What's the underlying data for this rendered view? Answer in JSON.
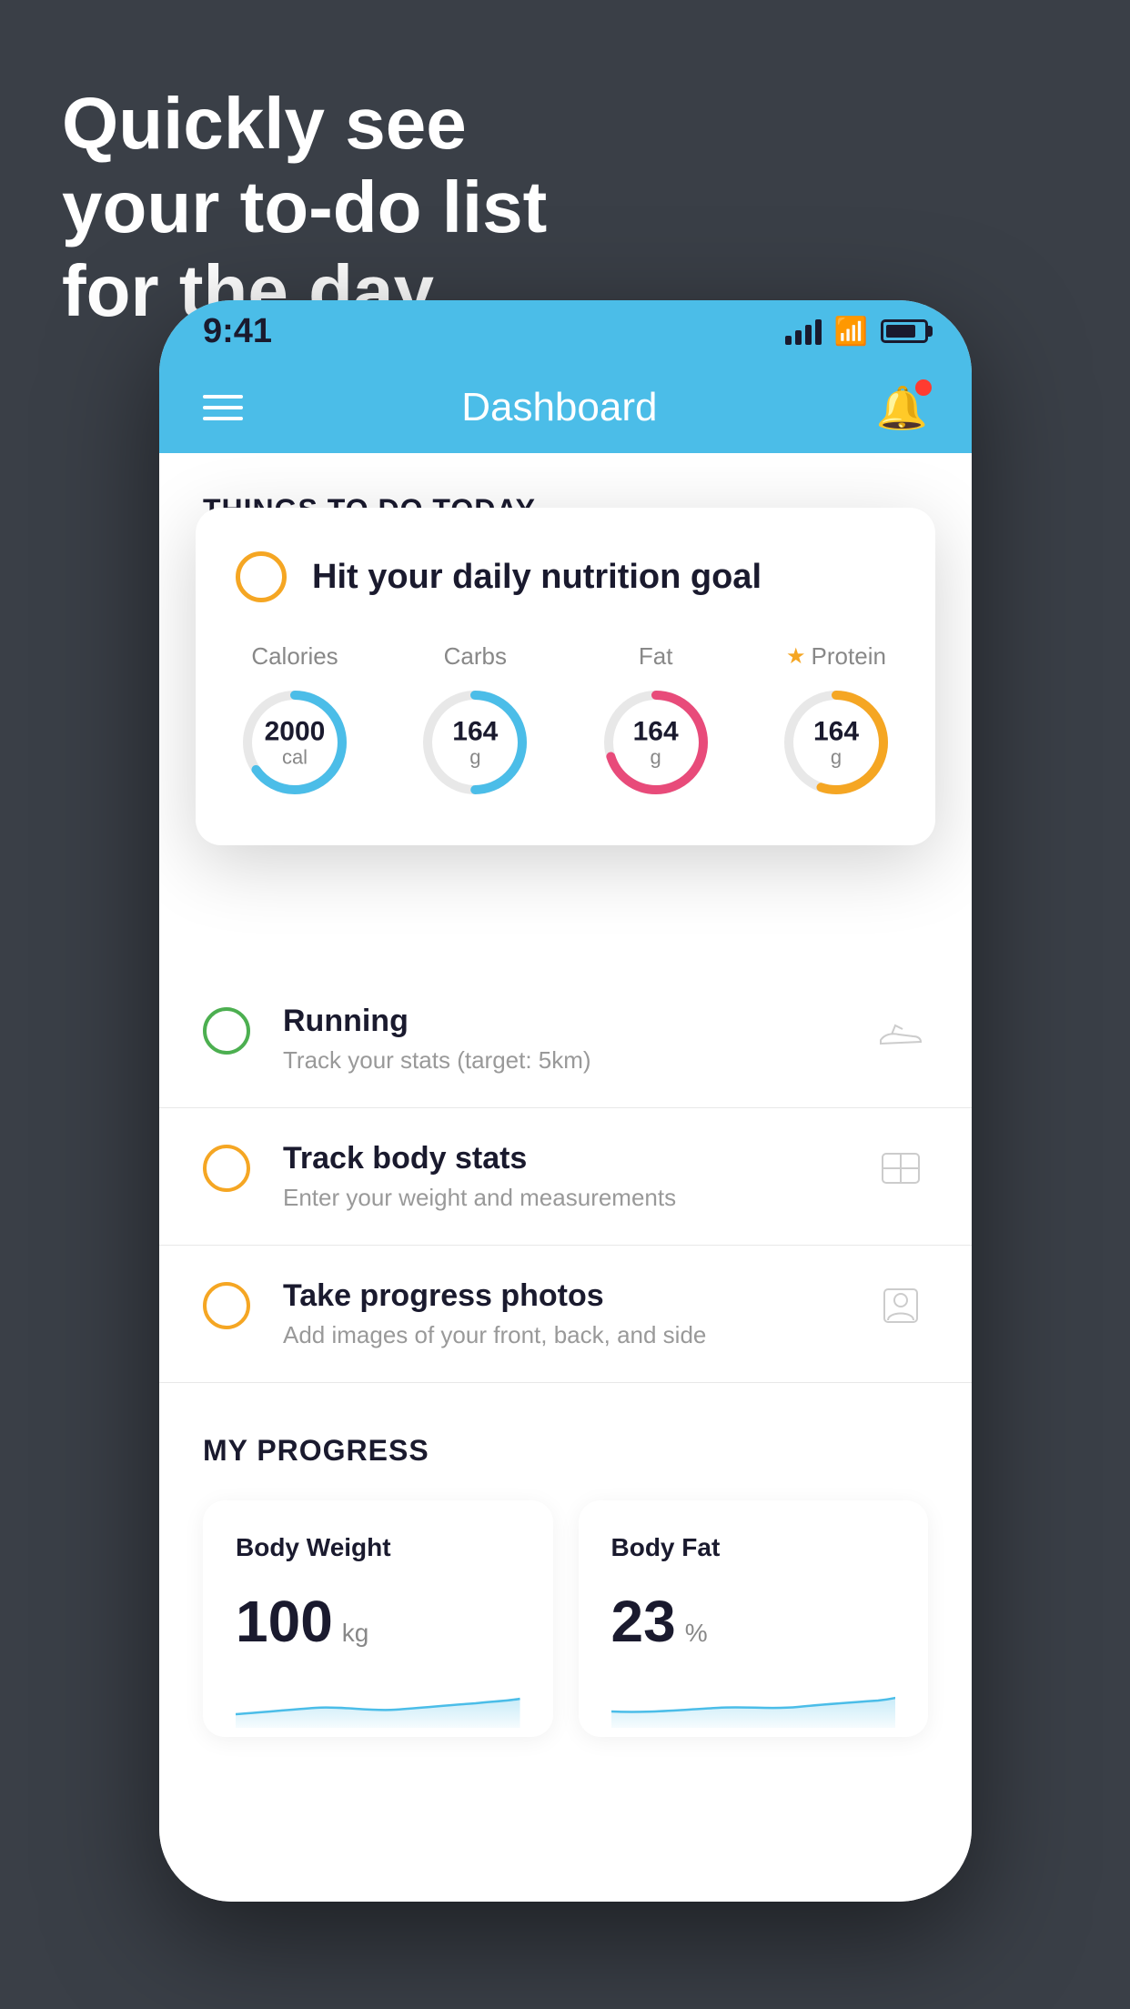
{
  "headline": {
    "line1": "Quickly see",
    "line2": "your to-do list",
    "line3": "for the day."
  },
  "status_bar": {
    "time": "9:41"
  },
  "header": {
    "title": "Dashboard"
  },
  "things_section": {
    "title": "THINGS TO DO TODAY"
  },
  "floating_card": {
    "title": "Hit your daily nutrition goal",
    "nutrition": [
      {
        "label": "Calories",
        "value": "2000",
        "unit": "cal",
        "color": "#4bbde8",
        "star": false,
        "pct": 65
      },
      {
        "label": "Carbs",
        "value": "164",
        "unit": "g",
        "color": "#4bbde8",
        "star": false,
        "pct": 50
      },
      {
        "label": "Fat",
        "value": "164",
        "unit": "g",
        "color": "#e84b7a",
        "star": false,
        "pct": 70
      },
      {
        "label": "Protein",
        "value": "164",
        "unit": "g",
        "color": "#f5a623",
        "star": true,
        "pct": 55
      }
    ]
  },
  "todo_items": [
    {
      "title": "Running",
      "subtitle": "Track your stats (target: 5km)",
      "circle_color": "green",
      "icon": "shoe"
    },
    {
      "title": "Track body stats",
      "subtitle": "Enter your weight and measurements",
      "circle_color": "yellow",
      "icon": "scale"
    },
    {
      "title": "Take progress photos",
      "subtitle": "Add images of your front, back, and side",
      "circle_color": "yellow2",
      "icon": "person"
    }
  ],
  "progress_section": {
    "title": "MY PROGRESS",
    "cards": [
      {
        "title": "Body Weight",
        "value": "100",
        "unit": "kg"
      },
      {
        "title": "Body Fat",
        "value": "23",
        "unit": "%"
      }
    ]
  }
}
